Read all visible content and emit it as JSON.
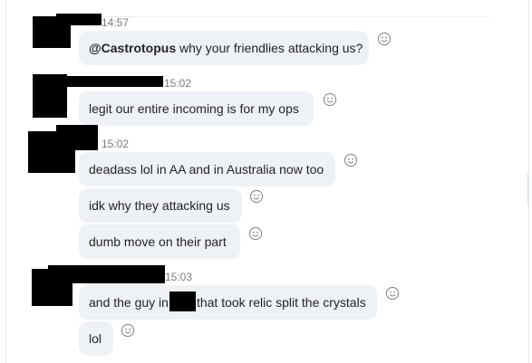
{
  "messages": {
    "m1": {
      "time": "14:57",
      "mention": "@Castrotopus",
      "text": " why your friendlies attacking us?"
    },
    "m2": {
      "time": "15:02",
      "text": "legit our entire incoming is for my ops"
    },
    "m3": {
      "time": "15:02",
      "text": "deadass lol in AA and in Australia now too"
    },
    "m4": {
      "text": "idk why they attacking us"
    },
    "m5": {
      "text": "dumb move on their part"
    },
    "m6": {
      "time": "15:03",
      "text_before": "and the guy in",
      "text_after": "that took relic split the crystals"
    },
    "m7": {
      "text": "lol"
    }
  },
  "icons": {
    "reaction": "smiley-face-icon",
    "redaction": "redacted-block"
  },
  "colors": {
    "bubble": "#eef1f6",
    "timestamp": "#7a7a7a",
    "redaction": "#000000",
    "icon": "#8a8a8a"
  }
}
